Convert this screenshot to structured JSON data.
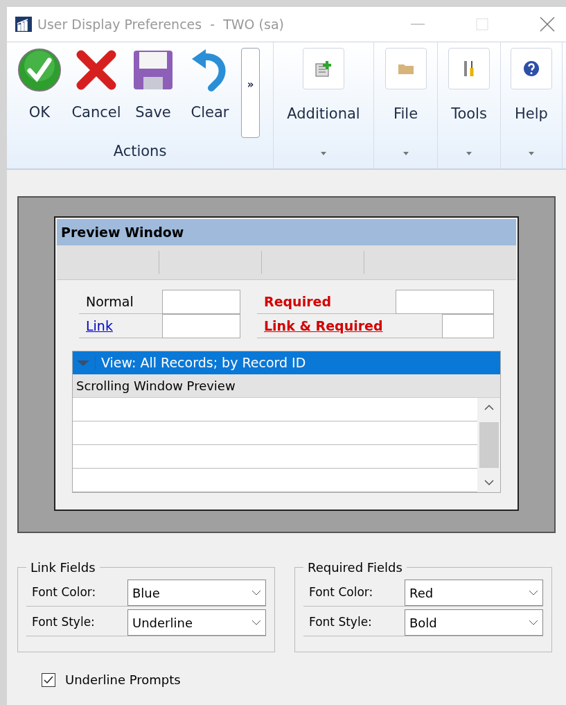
{
  "window": {
    "title": "User Display Preferences  -  TWO (sa)"
  },
  "ribbon": {
    "actions": {
      "label": "Actions",
      "overflow": "»",
      "buttons": [
        {
          "label": "OK",
          "kind": "ok"
        },
        {
          "label": "Cancel",
          "kind": "cancel"
        },
        {
          "label": "Save",
          "kind": "save"
        },
        {
          "label": "Clear",
          "kind": "clear"
        }
      ]
    },
    "groups": [
      {
        "label": "Additional",
        "kind": "additional"
      },
      {
        "label": "File",
        "kind": "file"
      },
      {
        "label": "Tools",
        "kind": "tools"
      },
      {
        "label": "Help",
        "kind": "help"
      }
    ]
  },
  "preview": {
    "title": "Preview Window",
    "left_fields": [
      {
        "label": "Normal",
        "kind": "normal"
      },
      {
        "label": "Link",
        "kind": "link"
      }
    ],
    "right_fields": [
      {
        "label": "Required",
        "kind": "required"
      },
      {
        "label": "Link & Required",
        "kind": "link_required"
      }
    ],
    "view_bar": "View: All Records; by Record ID",
    "grid_header": "Scrolling Window Preview"
  },
  "settings": [
    {
      "title": "Link Fields",
      "rows": [
        {
          "label": "Font Color:",
          "value": "Blue"
        },
        {
          "label": "Font Style:",
          "value": "Underline"
        }
      ]
    },
    {
      "title": "Required Fields",
      "rows": [
        {
          "label": "Font Color:",
          "value": "Red"
        },
        {
          "label": "Font Style:",
          "value": "Bold"
        }
      ]
    }
  ],
  "underline_prompts": {
    "label": "Underline Prompts",
    "checked": true
  }
}
